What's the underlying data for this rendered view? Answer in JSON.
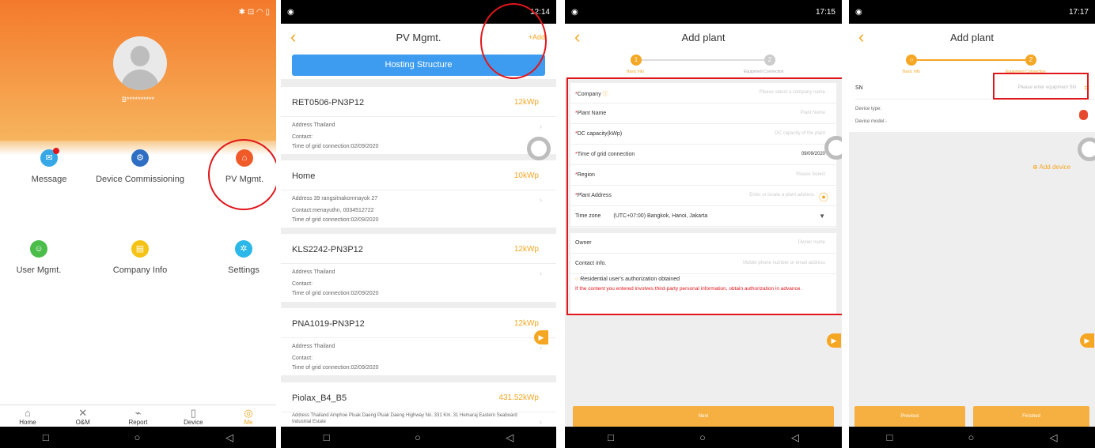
{
  "home": {
    "username": "B**********",
    "menu": [
      {
        "label": "Message",
        "icon": "message-icon",
        "color": "#36a8e8"
      },
      {
        "label": "Device Commissioning",
        "icon": "commissioning-icon",
        "color": "#2e6fc4"
      },
      {
        "label": "PV Mgmt.",
        "icon": "pv-home-icon",
        "color": "#f05a28"
      },
      {
        "label": "User Mgmt.",
        "icon": "user-icon",
        "color": "#4bbd4b"
      },
      {
        "label": "Company Info",
        "icon": "company-icon",
        "color": "#f5c216"
      },
      {
        "label": "Settings",
        "icon": "settings-icon",
        "color": "#2bb7e8"
      }
    ],
    "tabs": [
      {
        "label": "Home",
        "icon": "home-icon"
      },
      {
        "label": "O&M",
        "icon": "tools-icon"
      },
      {
        "label": "Report",
        "icon": "report-icon"
      },
      {
        "label": "Device",
        "icon": "device-icon"
      },
      {
        "label": "Me",
        "icon": "me-icon"
      }
    ]
  },
  "status": {
    "p2": "12:14",
    "p3": "17:15",
    "p4": "17:17"
  },
  "pv": {
    "title": "PV Mgmt.",
    "add": "+Add",
    "hosting": "Hosting Structure",
    "plants": [
      {
        "name": "RET0506-PN3P12",
        "cap": "12kWp",
        "address": "Address Thailand",
        "contact": "Contact:",
        "time": "Time of grid connection:02/09/2020"
      },
      {
        "name": "Home",
        "cap": "10kWp",
        "address": "Address 39 rangsitnakornnayok 27",
        "contact": "Contact:menayuthn, 0034512722",
        "time": "Time of grid connection:02/09/2020"
      },
      {
        "name": "KLS2242-PN3P12",
        "cap": "12kWp",
        "address": "Address Thailand",
        "contact": "Contact:",
        "time": "Time of grid connection:02/09/2020"
      },
      {
        "name": "PNA1019-PN3P12",
        "cap": "12kWp",
        "address": "Address Thailand",
        "contact": "Contact:",
        "time": "Time of grid connection:02/09/2020"
      },
      {
        "name": "Piolax_B4_B5",
        "cap": "431.52kWp",
        "address": "Address Thailand Amphoe Pluak Daeng Pluak Daeng Highway No. 331 Km. 31 Hemaraj Eastern Seaboard Industrial Estate",
        "contact": "",
        "time": ""
      }
    ]
  },
  "addplant": {
    "title": "Add plant",
    "step1": "1",
    "step2": "2",
    "step1_label": "Basic Info",
    "step2_label": "Equipment Connection",
    "fields": [
      {
        "label": "Company",
        "req": "*",
        "value": "Please select a company name"
      },
      {
        "label": "Plant Name",
        "req": "*",
        "value": "Plant Name"
      },
      {
        "label": "DC capacity(kWp)",
        "req": "*",
        "value": "DC capacity of the plant"
      },
      {
        "label": "Time of grid connection",
        "req": "*",
        "value": "09/09/2020"
      },
      {
        "label": "Region",
        "req": "*",
        "value": "Please Select"
      },
      {
        "label": "Plant Address",
        "req": "*",
        "value": "Enter or locate a plant address"
      },
      {
        "label": "Time zone",
        "req": "",
        "value": "(UTC+07:00) Bangkok, Hanoi, Jakarta"
      },
      {
        "label": "Owner",
        "req": "",
        "value": "Owner name"
      },
      {
        "label": "Contact info.",
        "req": "",
        "value": "Mobile phone number or email address"
      }
    ],
    "consent": "Residential user's authorization obtained",
    "warning": "If the content you entered involves third-party personal information, obtain authorization in advance.",
    "next": "Next"
  },
  "equip": {
    "title": "Add plant",
    "step1_label": "Basic Info",
    "step2_label": "Equipment Connection",
    "sn_label": "SN",
    "sn_placeholder": "Please enter equipment SN",
    "device_type": "Device type:",
    "device_model": "Device model:-",
    "add_device": "Add device",
    "previous": "Previous",
    "finished": "Finished"
  }
}
